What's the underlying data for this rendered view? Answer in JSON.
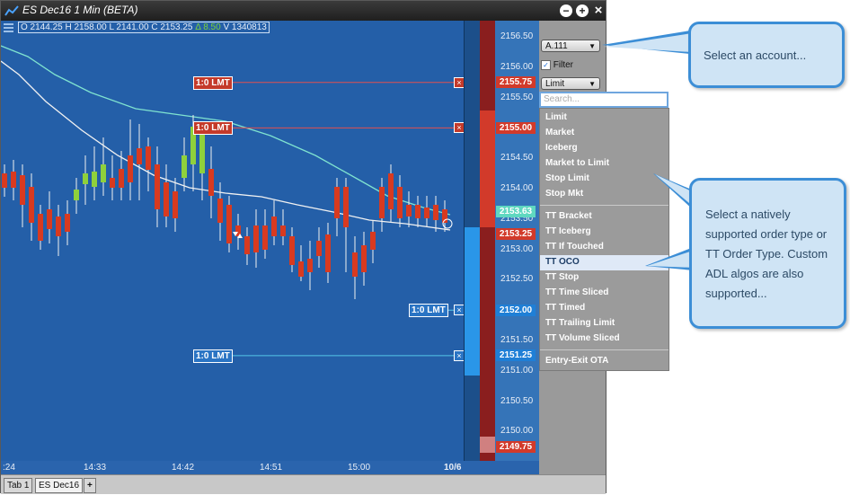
{
  "window": {
    "title": "ES Dec16 1 Min (BETA)",
    "buttons": [
      "−",
      "+",
      "×"
    ]
  },
  "ohlc": {
    "open": "O 2144.25",
    "high": "H 2158.00",
    "low": "L 2141.00",
    "close": "C 2153.25",
    "change": "Δ 8.50",
    "volume": "V 1340813"
  },
  "price_labels": [
    "2156.50",
    "2156.00",
    "2155.50",
    "2155.00",
    "2154.50",
    "2154.00",
    "2153.50",
    "2153.00",
    "2152.50",
    "2152.00",
    "2151.50",
    "2151.00",
    "2150.50",
    "2150.00"
  ],
  "price_boxes": [
    {
      "text": "2155.75",
      "color": "#d23a2a"
    },
    {
      "text": "2155.00",
      "color": "#d23a2a"
    },
    {
      "text": "2153.63",
      "color": "#5fd8c0"
    },
    {
      "text": "2153.25",
      "color": "#d23a2a"
    },
    {
      "text": "2152.00",
      "color": "#1f7fd6"
    },
    {
      "text": "2151.25",
      "color": "#1f7fd6"
    },
    {
      "text": "2149.75",
      "color": "#d23a2a"
    }
  ],
  "orders": [
    {
      "label": "1:0 LMT",
      "side": "sell"
    },
    {
      "label": "1:0 LMT",
      "side": "sell"
    },
    {
      "label": "1:0 LMT",
      "side": "buy"
    },
    {
      "label": "1:0 LMT",
      "side": "buy"
    }
  ],
  "order_cancel": "⊠",
  "x_labels": [
    ":24",
    "14:33",
    "14:42",
    "14:51",
    "15:00",
    "10/6"
  ],
  "tabs": [
    "Tab 1",
    "ES Dec16",
    "+"
  ],
  "sidebar": {
    "account": "A.111",
    "filter_label": "Filter",
    "order_type": "Limit",
    "dropdown_arrow": "▼"
  },
  "dropdown": {
    "search_placeholder": "Search...",
    "native": [
      "Limit",
      "Market",
      "Iceberg",
      "Market to Limit",
      "Stop Limit",
      "Stop Mkt"
    ],
    "tt": [
      "TT Bracket",
      "TT Iceberg",
      "TT If Touched",
      "TT OCO",
      "TT Stop",
      "TT Time Sliced",
      "TT Timed",
      "TT Trailing Limit",
      "TT Volume Sliced"
    ],
    "adl": [
      "Entry-Exit OTA"
    ],
    "highlighted": "TT OCO"
  },
  "callouts": {
    "account": "Select an account...",
    "order_type": "Select a natively supported order type or TT Order Type. Custom ADL algos are also supported..."
  },
  "colors": {
    "chart_bg": "#245fa8",
    "up_candle": "#8fd13b",
    "down_candle": "#d83a20",
    "sell_line": "#e05050",
    "buy_line": "#55c8e8",
    "callout_border": "#3c8ed6"
  }
}
